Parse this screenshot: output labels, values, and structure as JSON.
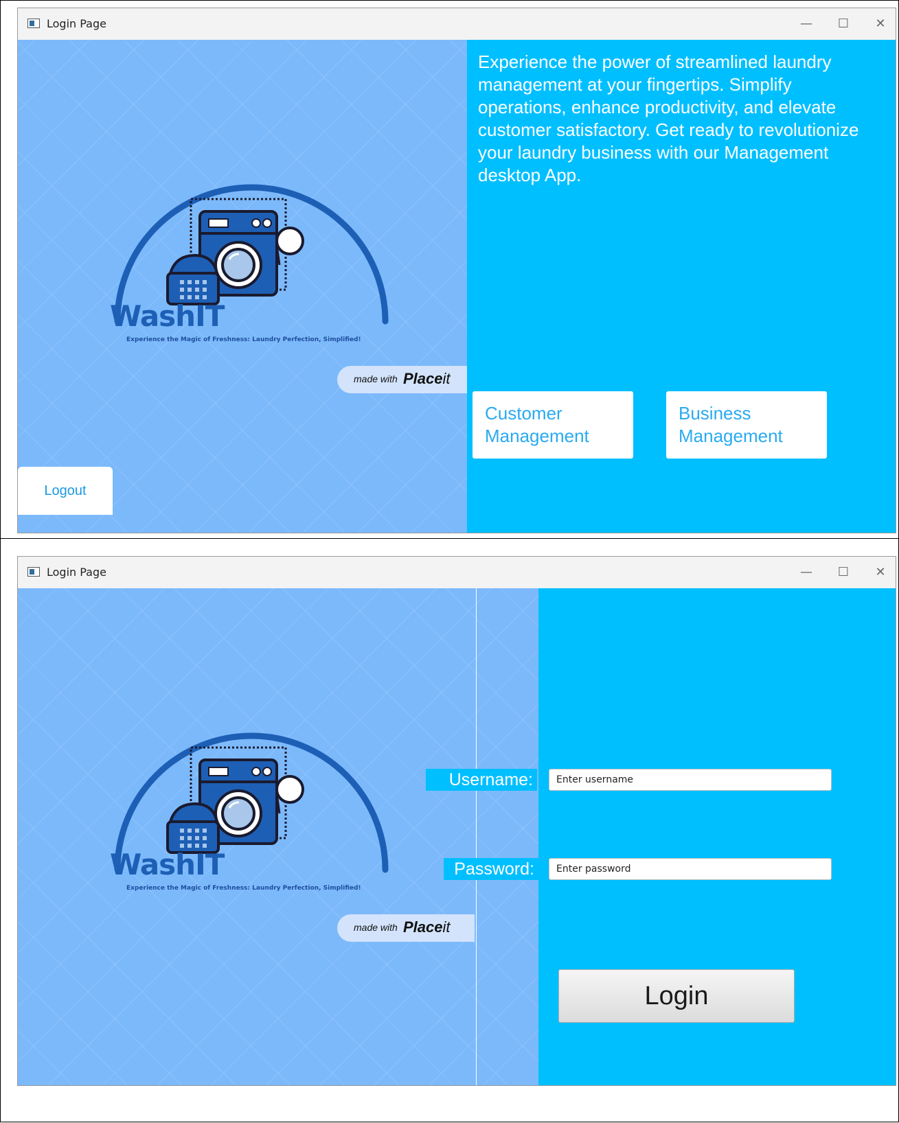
{
  "window": {
    "title": "Login Page",
    "controls": {
      "minimize": "—",
      "maximize": "☐",
      "close": "✕"
    }
  },
  "branding": {
    "name": "WashIT",
    "tagline": "Experience the Magic of Freshness: Laundry Perfection, Simplified!",
    "made_with_small": "made with",
    "made_with_brand_bold": "Place",
    "made_with_brand_light": "it"
  },
  "home_screen": {
    "intro_text": "Experience the power of streamlined laundry management at your fingertips. Simplify operations, enhance productivity, and elevate customer satisfactory. Get ready to revolutionize your laundry business with our Management desktop App.",
    "customer_button": "Customer Management",
    "business_button": "Business Management",
    "logout_button": "Logout"
  },
  "login_screen": {
    "username_label": "Username:",
    "username_placeholder": "Enter username",
    "password_label": "Password:",
    "password_placeholder": "Enter password",
    "login_button": "Login"
  },
  "colors": {
    "left_panel": "#7cb9fb",
    "right_panel": "#00bfff",
    "logo_blue": "#1d5fb5",
    "button_text": "#2aaaf0"
  }
}
